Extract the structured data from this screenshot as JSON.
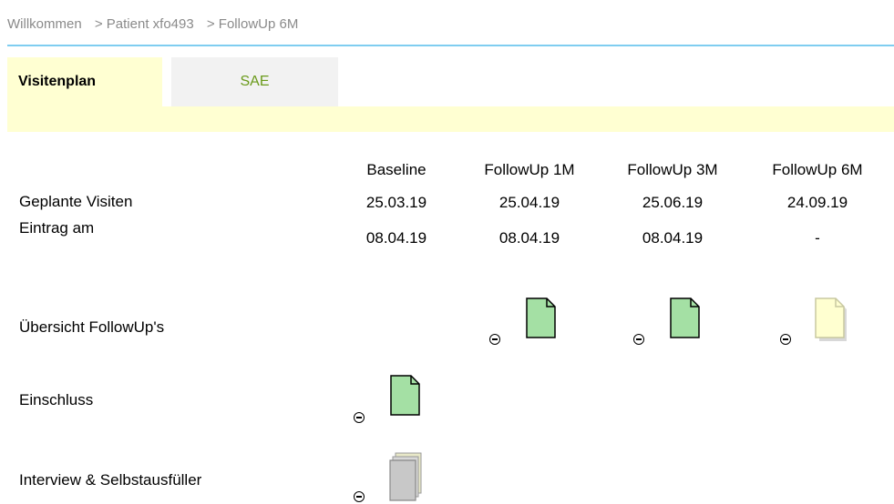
{
  "breadcrumb": {
    "items": [
      "Willkommen",
      "> Patient xfo493",
      "> FollowUp 6M"
    ]
  },
  "tabs": [
    {
      "label": "Visitenplan",
      "active": true
    },
    {
      "label": "SAE",
      "active": false
    }
  ],
  "schedule": {
    "columns": [
      "Baseline",
      "FollowUp 1M",
      "FollowUp 3M",
      "FollowUp 6M"
    ],
    "rows": {
      "planned_label": "Geplante Visiten",
      "entry_label": "Eintrag am",
      "planned": [
        "25.03.19",
        "25.04.19",
        "25.06.19",
        "24.09.19"
      ],
      "entry": [
        "08.04.19",
        "08.04.19",
        "08.04.19",
        "-"
      ]
    }
  },
  "forms": {
    "overview_label": "Übersicht FollowUp's",
    "inclusion_label": "Einschluss",
    "interview_label": "Interview & Selbstausfüller"
  },
  "colors": {
    "doc_complete": "#a4e0a4",
    "doc_pending": "#ffffd0",
    "doc_gray": "#c8c8c8",
    "tab_strip": "#ffffd2",
    "link_green": "#6a9a1a",
    "top_rule": "#7fcdf0"
  }
}
